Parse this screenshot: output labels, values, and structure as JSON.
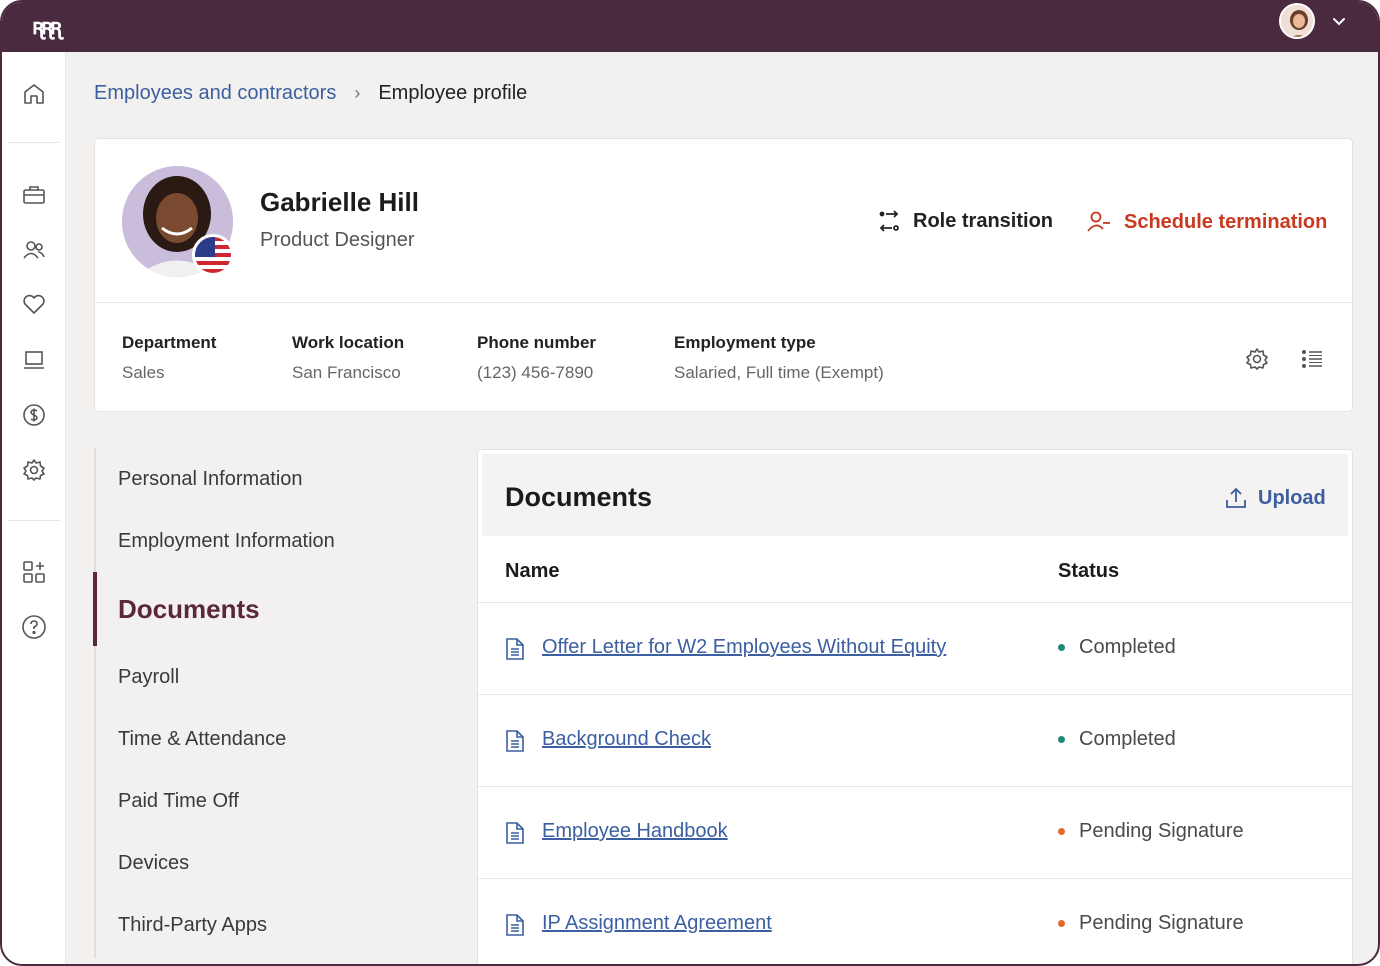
{
  "app": {
    "logo_text": "ꭆꭆꭆ"
  },
  "breadcrumb": {
    "parent": "Employees and contractors",
    "separator": "›",
    "current": "Employee profile"
  },
  "profile": {
    "name": "Gabrielle Hill",
    "title": "Product Designer",
    "actions": {
      "role_transition": "Role transition",
      "schedule_termination": "Schedule termination"
    },
    "fields": [
      {
        "label": "Department",
        "value": "Sales"
      },
      {
        "label": "Work location",
        "value": "San Francisco"
      },
      {
        "label": "Phone number",
        "value": "(123) 456-7890"
      },
      {
        "label": "Employment type",
        "value": "Salaried, Full time (Exempt)"
      }
    ]
  },
  "subnav": {
    "items": [
      "Personal Information",
      "Employment Information",
      "Documents",
      "Payroll",
      "Time & Attendance",
      "Paid Time Off",
      "Devices",
      "Third-Party Apps"
    ],
    "active": "Documents"
  },
  "documents": {
    "title": "Documents",
    "upload_label": "Upload",
    "columns": {
      "name": "Name",
      "status": "Status"
    },
    "rows": [
      {
        "name": "Offer Letter for W2 Employees Without Equity",
        "status": "Completed",
        "status_color": "#1f8a7a"
      },
      {
        "name": "Background Check",
        "status": "Completed",
        "status_color": "#1f8a7a"
      },
      {
        "name": "Employee Handbook",
        "status": "Pending Signature",
        "status_color": "#e06a2c"
      },
      {
        "name": "IP Assignment Agreement",
        "status": "Pending Signature",
        "status_color": "#e06a2c"
      }
    ]
  },
  "sidebar_icons": [
    "home-icon",
    "briefcase-icon",
    "people-icon",
    "heart-icon",
    "laptop-icon",
    "dollar-icon",
    "settings-icon",
    "apps-icon",
    "help-icon"
  ],
  "colors": {
    "topbar": "#4a2a3e",
    "link": "#3b5fa1",
    "danger": "#c8391f",
    "active": "#5a2838"
  }
}
